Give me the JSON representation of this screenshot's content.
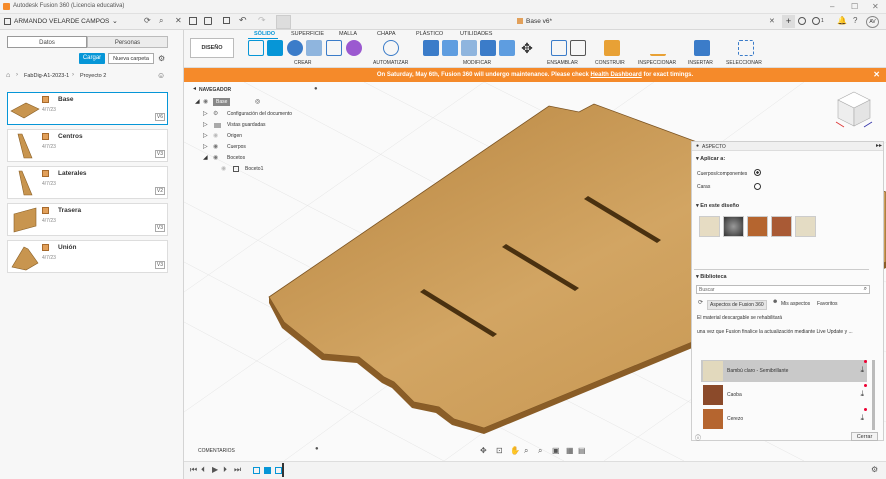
{
  "title": "Autodesk Fusion 360 (Licencia educativa)",
  "app": {
    "user": "ARMANDO VELARDE CAMPOS",
    "doc_tab": "Base v6*",
    "avatar": "AV",
    "notif_count": "1"
  },
  "data_panel": {
    "tab_data": "Datos",
    "tab_people": "Personas",
    "upload": "Cargar",
    "new_folder": "Nueva carpeta",
    "breadcrumb_1": "FabDig-A1-2023-1",
    "breadcrumb_2": "Proyecto 2",
    "items": [
      {
        "name": "Base",
        "date": "4/7/23",
        "version": "V6"
      },
      {
        "name": "Centros",
        "date": "4/7/23",
        "version": "V3"
      },
      {
        "name": "Laterales",
        "date": "4/7/23",
        "version": "V2"
      },
      {
        "name": "Trasera",
        "date": "4/7/23",
        "version": "V3"
      },
      {
        "name": "Unión",
        "date": "4/7/23",
        "version": "V3"
      }
    ]
  },
  "toolbar": {
    "workspace": "DISEÑO",
    "tabs": [
      "SÓLIDO",
      "SUPERFICIE",
      "MALLA",
      "CHAPA",
      "PLÁSTICO",
      "UTILIDADES"
    ],
    "groups": [
      "CREAR",
      "AUTOMATIZAR",
      "MODIFICAR",
      "ENSAMBLAR",
      "CONSTRUIR",
      "INSPECCIONAR",
      "INSERTAR",
      "SELECCIONAR"
    ]
  },
  "banner": {
    "text_a": "On Saturday, May 6th, Fusion 360 will undergo maintenance. Please check ",
    "link": "Health Dashboard",
    "text_b": " for exact timings."
  },
  "browser": {
    "header": "NAVEGADOR",
    "root": "Base v6",
    "rows": [
      "Configuración del documento",
      "Vistas guardadas",
      "Origen",
      "Cuerpos",
      "Bocetos",
      "Boceto1"
    ]
  },
  "aspect": {
    "header": "ASPECTO",
    "apply_to": "Aplicar a:",
    "opt_bodies": "Cuerpos/componentes",
    "opt_faces": "Caras",
    "in_design": "En este diseño",
    "library": "Biblioteca",
    "search_placeholder": "Buscar",
    "lib_tabs": [
      "Aspectos de Fusion 360",
      "Mis aspectos",
      "Favoritos"
    ],
    "msg1": "El material descargable se rehabilitará",
    "msg2": "una vez que Fusion finalice la actualización mediante Live Update y ...",
    "items": [
      "Bambú claro - Semibrillante",
      "Caoba",
      "Cerezo"
    ],
    "close": "Cerrar"
  },
  "comments": "COMENTARIOS",
  "colors": {
    "banner": "#f58a2a",
    "accent": "#0696d7",
    "wood": "#c8954f"
  }
}
